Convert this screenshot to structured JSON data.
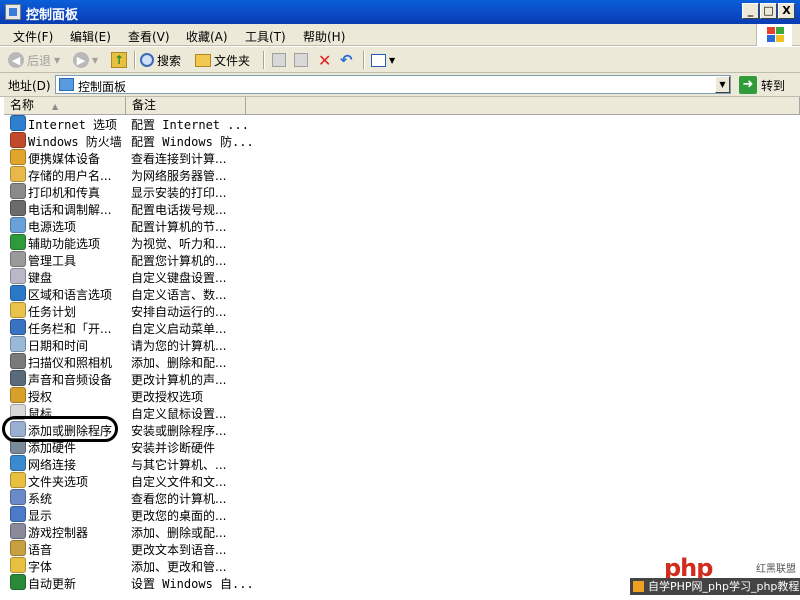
{
  "window": {
    "title": "控制面板",
    "buttons": {
      "minimize": "_",
      "maximize": "□",
      "close": "X"
    }
  },
  "menu": {
    "items": [
      "文件(F)",
      "编辑(E)",
      "查看(V)",
      "收藏(A)",
      "工具(T)",
      "帮助(H)"
    ]
  },
  "toolbar": {
    "back": "后退",
    "search": "搜索",
    "folders": "文件夹"
  },
  "address": {
    "label": "地址(D)",
    "value": "控制面板",
    "go": "转到"
  },
  "columns": {
    "name": "名称",
    "desc": "备注"
  },
  "items": [
    {
      "name": "Internet 选项",
      "desc": "配置 Internet ...",
      "icon": "internet-options-icon",
      "color": "#2f7fd1"
    },
    {
      "name": "Windows 防火墙",
      "desc": "配置 Windows 防...",
      "icon": "firewall-icon",
      "color": "#c24a2c"
    },
    {
      "name": "便携媒体设备",
      "desc": "查看连接到计算...",
      "icon": "portable-media-icon",
      "color": "#e0a52a"
    },
    {
      "name": "存储的用户名...",
      "desc": "为网络服务器管...",
      "icon": "stored-users-icon",
      "color": "#e8b84a"
    },
    {
      "name": "打印机和传真",
      "desc": "显示安装的打印...",
      "icon": "printer-icon",
      "color": "#8a8a8a"
    },
    {
      "name": "电话和调制解...",
      "desc": "配置电话拨号规...",
      "icon": "phone-modem-icon",
      "color": "#6b6b6b"
    },
    {
      "name": "电源选项",
      "desc": "配置计算机的节...",
      "icon": "power-options-icon",
      "color": "#6aa1d8"
    },
    {
      "name": "辅助功能选项",
      "desc": "为视觉、听力和...",
      "icon": "accessibility-icon",
      "color": "#2e9a3a"
    },
    {
      "name": "管理工具",
      "desc": "配置您计算机的...",
      "icon": "admin-tools-icon",
      "color": "#9a9a9a"
    },
    {
      "name": "键盘",
      "desc": "自定义键盘设置...",
      "icon": "keyboard-icon",
      "color": "#b8b8c8"
    },
    {
      "name": "区域和语言选项",
      "desc": "自定义语言、数...",
      "icon": "region-language-icon",
      "color": "#2a78c8"
    },
    {
      "name": "任务计划",
      "desc": "安排自动运行的...",
      "icon": "scheduled-tasks-icon",
      "color": "#e8c24a"
    },
    {
      "name": "任务栏和「开...",
      "desc": "自定义启动菜单...",
      "icon": "taskbar-icon",
      "color": "#3a72c2"
    },
    {
      "name": "日期和时间",
      "desc": "请为您的计算机...",
      "icon": "date-time-icon",
      "color": "#9ab8d8"
    },
    {
      "name": "扫描仪和照相机",
      "desc": "添加、删除和配...",
      "icon": "scanner-camera-icon",
      "color": "#7a7a7a"
    },
    {
      "name": "声音和音频设备",
      "desc": "更改计算机的声...",
      "icon": "sound-icon",
      "color": "#5a6a7a"
    },
    {
      "name": "授权",
      "desc": "更改授权选项",
      "icon": "licensing-icon",
      "color": "#d8a02a"
    },
    {
      "name": "鼠标",
      "desc": "自定义鼠标设置...",
      "icon": "mouse-icon",
      "color": "#d8d8d8"
    },
    {
      "name": "添加或删除程序",
      "desc": "安装或删除程序...",
      "icon": "add-remove-programs-icon",
      "color": "#9ab0d0"
    },
    {
      "name": "添加硬件",
      "desc": "安装并诊断硬件",
      "icon": "add-hardware-icon",
      "color": "#7a8a9a"
    },
    {
      "name": "网络连接",
      "desc": "与其它计算机、...",
      "icon": "network-connections-icon",
      "color": "#3a8ad0"
    },
    {
      "name": "文件夹选项",
      "desc": "自定义文件和文...",
      "icon": "folder-options-icon",
      "color": "#e8c040"
    },
    {
      "name": "系统",
      "desc": "查看您的计算机...",
      "icon": "system-icon",
      "color": "#6a8ac8"
    },
    {
      "name": "显示",
      "desc": "更改您的桌面的...",
      "icon": "display-icon",
      "color": "#4a7ac8"
    },
    {
      "name": "游戏控制器",
      "desc": "添加、删除或配...",
      "icon": "game-controller-icon",
      "color": "#8a8a9a"
    },
    {
      "name": "语音",
      "desc": "更改文本到语音...",
      "icon": "speech-icon",
      "color": "#c8a040"
    },
    {
      "name": "字体",
      "desc": "添加、更改和管...",
      "icon": "fonts-icon",
      "color": "#e8c040"
    },
    {
      "name": "自动更新",
      "desc": "设置 Windows 自...",
      "icon": "automatic-updates-icon",
      "color": "#2a8a3a"
    }
  ],
  "watermark": {
    "logo": "php",
    "logo_sub": "红黑联盟",
    "bar": "自学PHP网_php学习_php教程"
  }
}
